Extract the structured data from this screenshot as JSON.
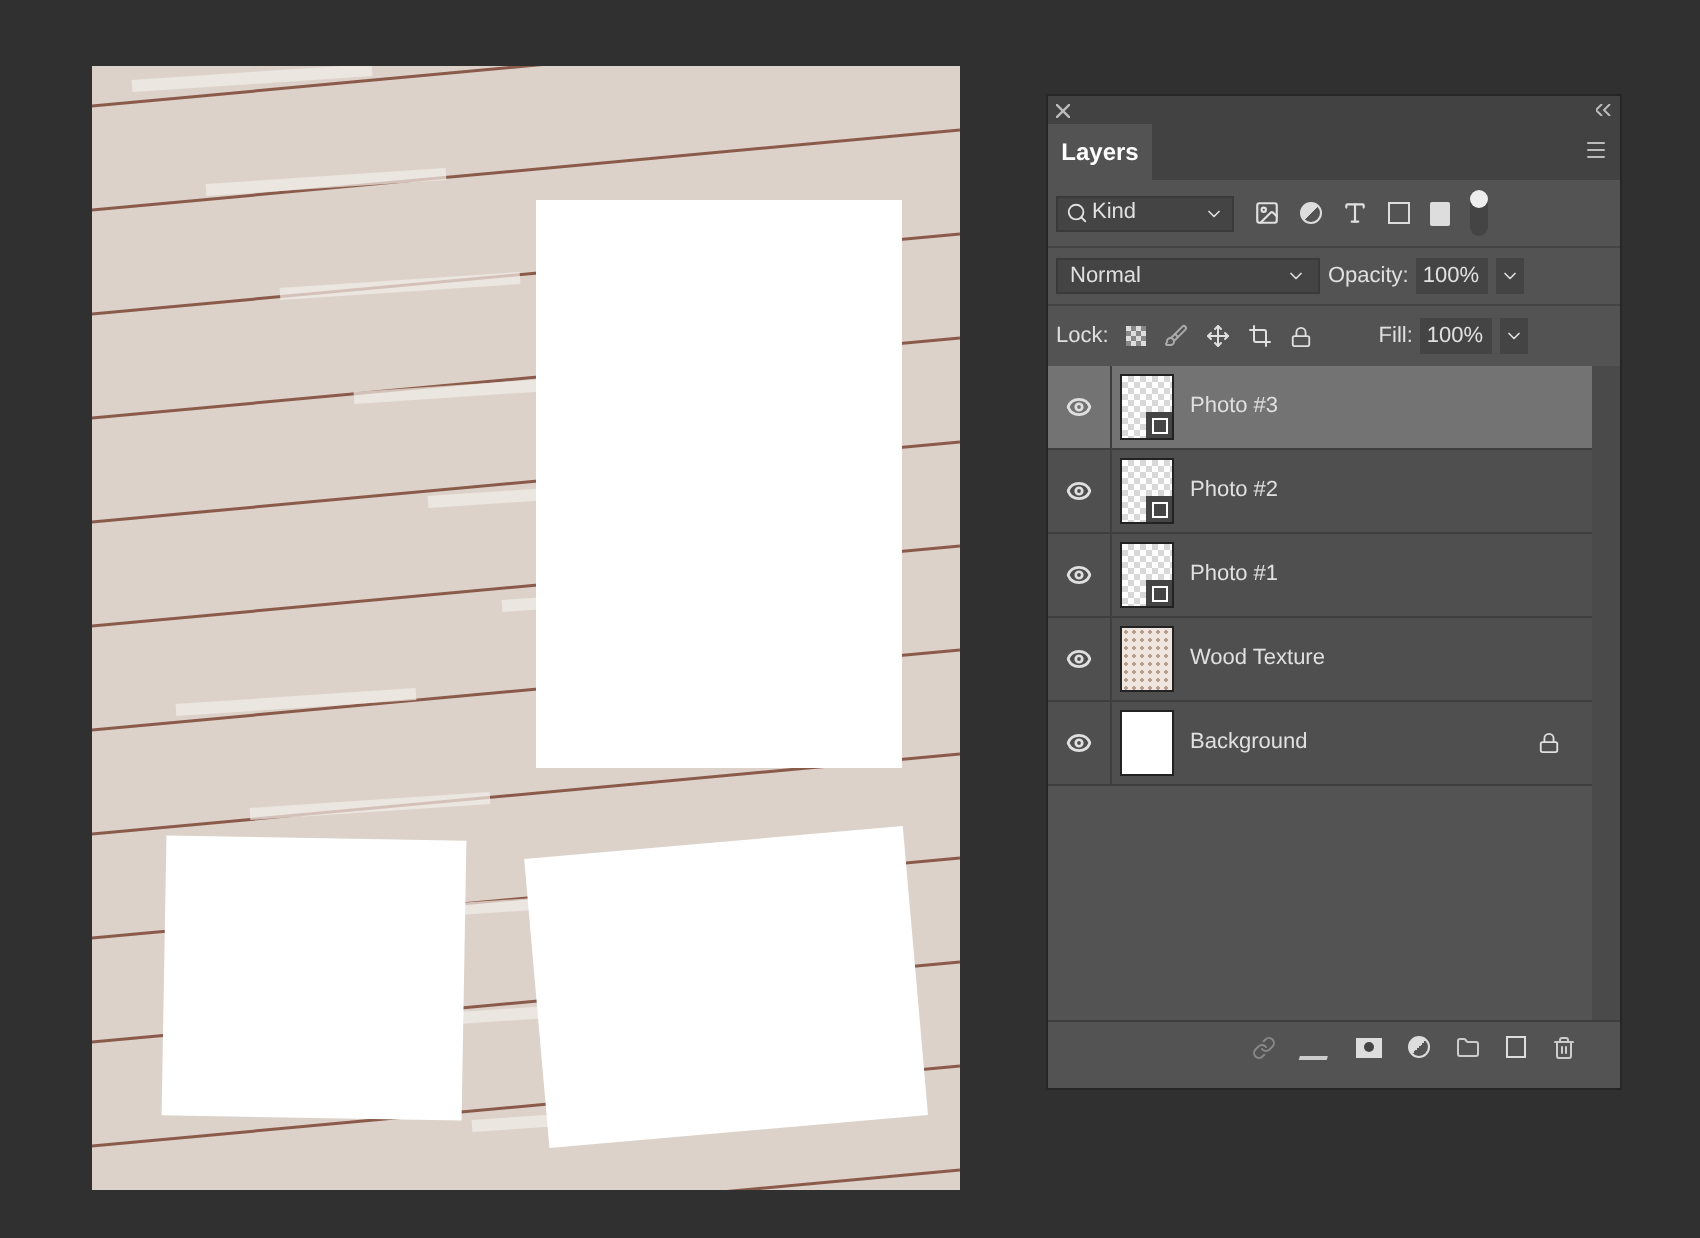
{
  "panel": {
    "title": "Layers",
    "filter": {
      "value": "Kind",
      "on": true
    },
    "blend_mode": {
      "value": "Normal"
    },
    "opacity": {
      "label": "Opacity:",
      "value": "100%"
    },
    "lock": {
      "label": "Lock:"
    },
    "fill": {
      "label": "Fill:",
      "value": "100%"
    },
    "layers": [
      {
        "name": "Photo #3",
        "kind": "smart",
        "selected": true,
        "visible": true,
        "locked": false
      },
      {
        "name": "Photo #2",
        "kind": "smart",
        "selected": false,
        "visible": true,
        "locked": false
      },
      {
        "name": "Photo #1",
        "kind": "smart",
        "selected": false,
        "visible": true,
        "locked": false
      },
      {
        "name": "Wood Texture",
        "kind": "texture",
        "selected": false,
        "visible": true,
        "locked": false
      },
      {
        "name": "Background",
        "kind": "plain",
        "selected": false,
        "visible": true,
        "locked": true
      }
    ]
  }
}
